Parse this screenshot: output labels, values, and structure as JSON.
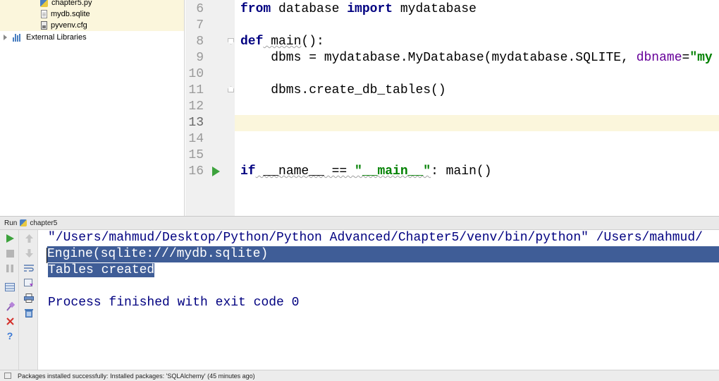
{
  "project_tree": {
    "items": [
      {
        "label": "chapter5.py",
        "icon": "python-file-icon"
      },
      {
        "label": "mydb.sqlite",
        "icon": "file-icon"
      },
      {
        "label": "pyvenv.cfg",
        "icon": "config-file-icon"
      },
      {
        "label": "External Libraries",
        "icon": "library-icon"
      }
    ]
  },
  "editor": {
    "line_numbers": [
      "6",
      "7",
      "8",
      "9",
      "10",
      "11",
      "12",
      "13",
      "14",
      "15",
      "16"
    ],
    "current_line": "13",
    "code": {
      "l6_kw1": "from",
      "l6_mid": " database ",
      "l6_kw2": "import",
      "l6_end": " mydatabase",
      "l8_kw": "def",
      "l8_name": " main",
      "l8_end": "():",
      "l9_a": "    dbms = mydatabase.MyDatabase(mydatabase.SQLITE, ",
      "l9_param": "dbname",
      "l9_eq": "=",
      "l9_str": "\"my",
      "l11": "    dbms.create_db_tables()",
      "l16_kw": "if",
      "l16_a": " __name__ == ",
      "l16_str": "\"__main__\"",
      "l16_end": ": main()"
    }
  },
  "run_panel": {
    "tab_label": "Run",
    "config_name": "chapter5",
    "console_lines": [
      "\"/Users/mahmud/Desktop/Python/Python Advanced/Chapter5/venv/bin/python\" /Users/mahmud/",
      "Engine(sqlite:///mydb.sqlite)",
      "Tables created",
      "",
      "Process finished with exit code 0"
    ]
  },
  "status_bar": {
    "message": "Packages installed successfully: Installed packages: 'SQLAlchemy' (45 minutes ago)"
  },
  "colors": {
    "keyword": "#000080",
    "string": "#008000",
    "selection": "#3f5d97",
    "current_line": "#fbf6dc",
    "run_green": "#3ca23c"
  }
}
